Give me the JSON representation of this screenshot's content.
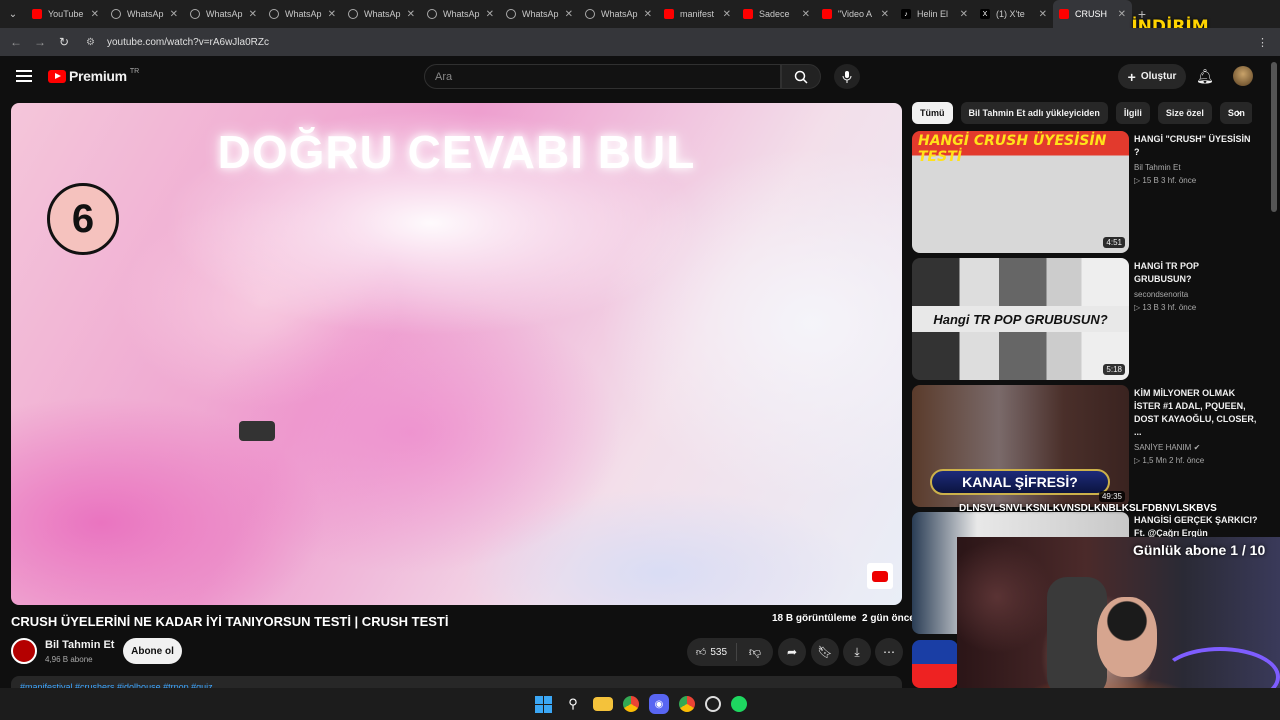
{
  "browser": {
    "tabs": [
      {
        "label": "YouTube",
        "icon": "youtube-icon"
      },
      {
        "label": "WhatsAp",
        "icon": "whatsapp-icon"
      },
      {
        "label": "WhatsAp",
        "icon": "whatsapp-icon"
      },
      {
        "label": "WhatsAp",
        "icon": "whatsapp-icon"
      },
      {
        "label": "WhatsAp",
        "icon": "whatsapp-icon"
      },
      {
        "label": "WhatsAp",
        "icon": "whatsapp-icon"
      },
      {
        "label": "WhatsAp",
        "icon": "whatsapp-icon"
      },
      {
        "label": "WhatsAp",
        "icon": "whatsapp-icon"
      },
      {
        "label": "manifest",
        "icon": "youtube-icon"
      },
      {
        "label": "Sadece",
        "icon": "youtube-icon"
      },
      {
        "label": "\"Video A",
        "icon": "youtube-icon"
      },
      {
        "label": "Helin El",
        "icon": "tiktok-icon"
      },
      {
        "label": "(1) X'te",
        "icon": "x-icon"
      },
      {
        "label": "CRUSH",
        "icon": "youtube-icon"
      }
    ],
    "url": "youtube.com/watch?v=rA6wJla0RZc",
    "promo": "İNDİRİM KODU: PERVER"
  },
  "masthead": {
    "logo": "Premium",
    "region": "TR",
    "search_placeholder": "Ara",
    "create_label": "Oluştur"
  },
  "video": {
    "overlay_title": "DOĞRU CEVABI BUL",
    "counter": "6",
    "title": "CRUSH ÜYELERİNİ NE KADAR İYİ TANIYORSUN TESTİ | CRUSH TESTİ",
    "views": "18 B görüntüleme",
    "age": "2 gün önce",
    "channel": "Bil Tahmin Et",
    "subscribers": "4,96 B abone",
    "subscribe_label": "Abone ol",
    "likes": "535",
    "hashtags": "#manifestival #crushers #idolhouse #trpop #quiz"
  },
  "chips": [
    "Tümü",
    "Bil Tahmin Et adlı yükleyiciden",
    "İlgili",
    "Size özel",
    "Son"
  ],
  "recommendations": [
    {
      "title": "HANGİ \"CRUSH\" ÜYESİSİN ?",
      "channel": "Bil Tahmin Et",
      "meta": "▷ 15 B  3 hf. önce",
      "duration": "4:51",
      "thumb_text": "HANGİ CRUSH ÜYESİSİN TESTİ"
    },
    {
      "title": "HANGİ TR POP GRUBUSUN?",
      "channel": "secondsenorita",
      "meta": "▷ 13 B  3 hf. önce",
      "duration": "5:18",
      "thumb_text": "Hangi TR POP GRUBUSUN?"
    },
    {
      "title": "KİM MİLYONER OLMAK İSTER #1 ADAL, PQUEEN, DOST KAYAOĞLU, CLOSER, ...",
      "channel": "SANİYE HANIM",
      "meta": "▷ 1,5 Mn  2 hf. önce",
      "duration": "49:35",
      "thumb_text": "KANAL ŞİFRESİ?"
    },
    {
      "title": "HANGİSİ GERÇEK ŞARKICI? Ft. @Çağrı Ergün",
      "channel": "",
      "meta": "",
      "duration": "",
      "thumb_text": ""
    }
  ],
  "stream_overlay": {
    "chat_line": "DLNSVLSNVLKSNLKVNSDLKNBLKSLFDBNVLSKBVS",
    "goal": "Günlük abone 1 / 10"
  }
}
